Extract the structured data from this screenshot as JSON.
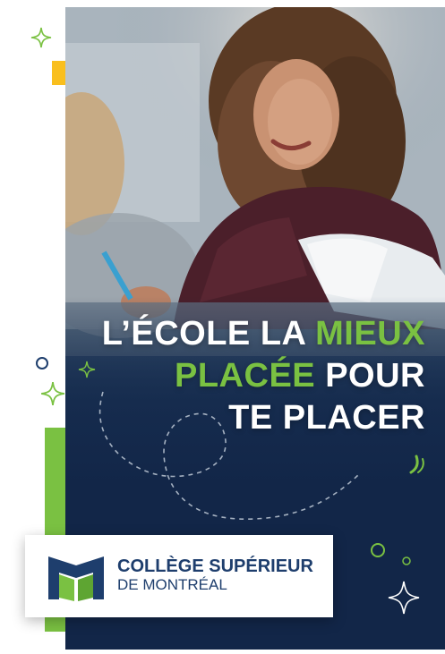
{
  "headline": {
    "line1_white": "L’ÉCOLE LA",
    "line1_green": "MIEUX",
    "line2_green": "PLACÉE",
    "line2_white": "POUR",
    "line3_white": "TE PLACER"
  },
  "logo": {
    "line1": "COLLÈGE SUPÉRIEUR",
    "line2": "DE MONTRÉAL"
  },
  "colors": {
    "brand_green": "#7ac142",
    "brand_navy": "#1e3e6d",
    "accent_yellow": "#f9bf1e"
  },
  "icons": [
    "sparkle-icon",
    "circle-outline-icon",
    "leaf-icon",
    "college-logo-mark-icon"
  ]
}
